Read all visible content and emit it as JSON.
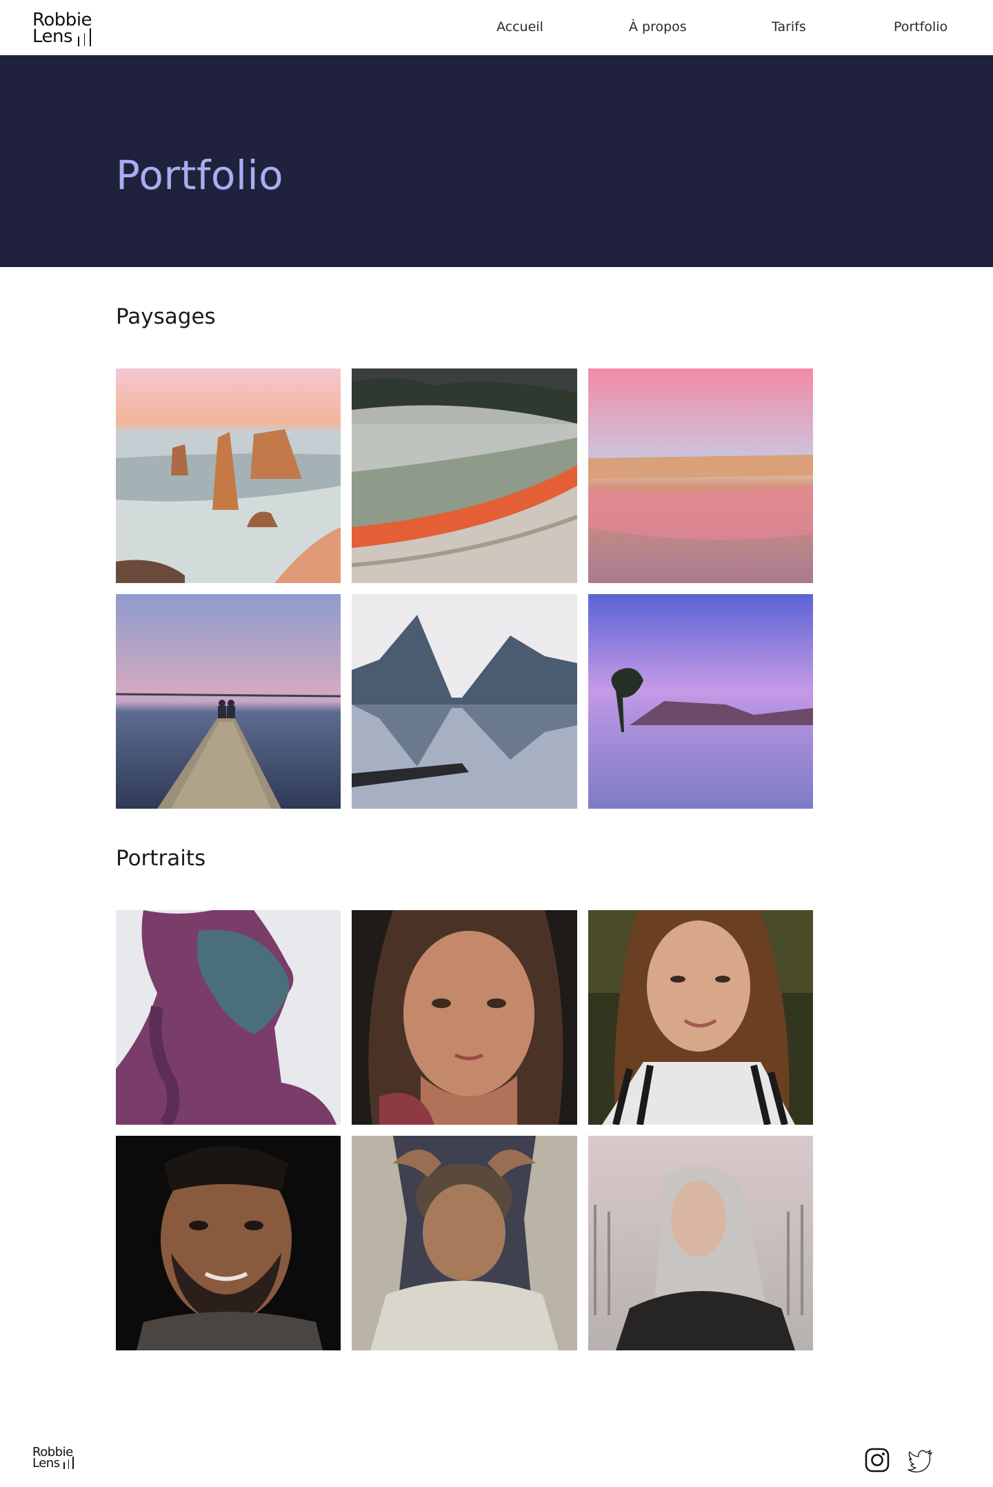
{
  "brand": {
    "line1": "Robbie",
    "line2": "Lens"
  },
  "nav": {
    "items": [
      {
        "label": "Accueil"
      },
      {
        "label": "À propos"
      },
      {
        "label": "Tarifs"
      },
      {
        "label": "Portfolio"
      }
    ]
  },
  "hero": {
    "title": "Portfolio"
  },
  "sections": [
    {
      "title": "Paysages",
      "photos": [
        "sea-stacks-coast",
        "steaming-geothermal-pool",
        "pink-sunset-beach",
        "wooden-pier-couple",
        "mountain-fjord-reflection",
        "purple-lake-tree"
      ]
    },
    {
      "title": "Portraits",
      "photos": [
        "woman-purple-braid",
        "woman-dark-hair",
        "woman-striped-shirt",
        "bearded-man",
        "man-hands-on-head",
        "woman-silver-hair"
      ]
    }
  ],
  "footer": {
    "social": [
      "instagram-icon",
      "twitter-icon"
    ]
  },
  "colors": {
    "hero_bg": "#20213c",
    "hero_title": "#a9adf0"
  }
}
